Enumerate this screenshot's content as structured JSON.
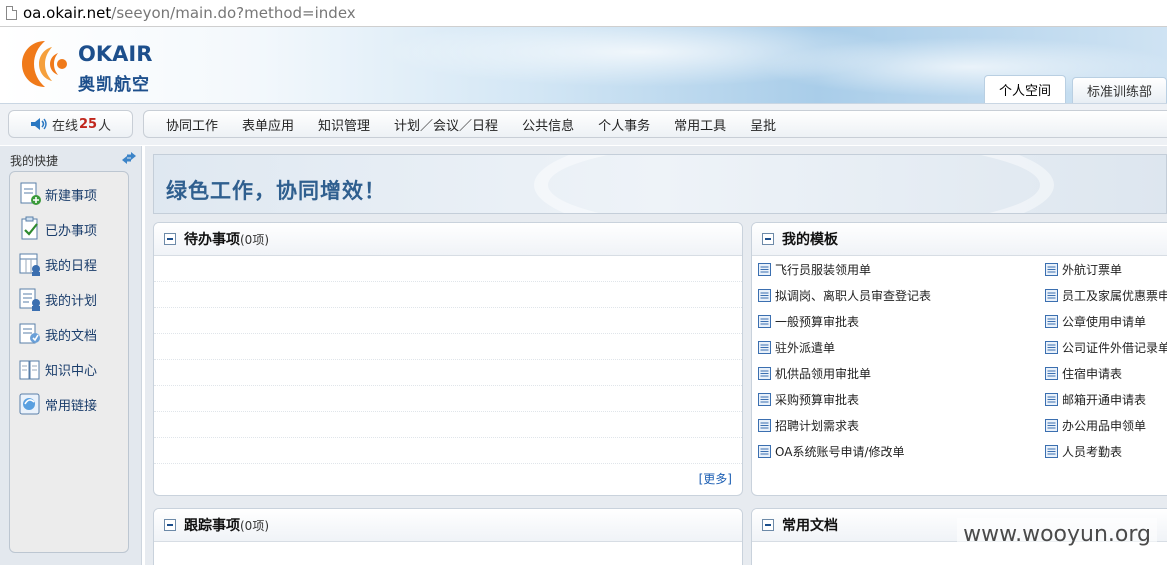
{
  "address_bar": {
    "domain": "oa.okair.net",
    "path": "/seeyon/main.do?method=index"
  },
  "header": {
    "logo_en": "OKAIR",
    "logo_cn": "奥凯航空",
    "tabs": [
      {
        "label": "个人空间",
        "active": true
      },
      {
        "label": "标准训练部",
        "active": false
      }
    ]
  },
  "online": {
    "prefix": "在线",
    "count": "25",
    "suffix": "人"
  },
  "menu": {
    "items": [
      "协同工作",
      "表单应用",
      "知识管理",
      "计划／会议／日程",
      "公共信息",
      "个人事务",
      "常用工具",
      "呈批"
    ]
  },
  "sidebar": {
    "title": "我的快捷",
    "items": [
      {
        "label": "新建事项",
        "icon": "new-item-icon"
      },
      {
        "label": "已办事项",
        "icon": "done-items-icon"
      },
      {
        "label": "我的日程",
        "icon": "calendar-icon"
      },
      {
        "label": "我的计划",
        "icon": "plan-icon"
      },
      {
        "label": "我的文档",
        "icon": "document-icon"
      },
      {
        "label": "知识中心",
        "icon": "book-icon"
      },
      {
        "label": "常用链接",
        "icon": "link-icon"
      }
    ]
  },
  "banner": {
    "slogan": "绿色工作，协同增效！"
  },
  "panels": {
    "todo": {
      "title": "待办事项",
      "count": "(0项)",
      "more": "[更多]"
    },
    "templates": {
      "title": "我的模板",
      "items_left": [
        "飞行员服装领用单",
        "拟调岗、离职人员审查登记表",
        "一般预算审批表",
        "驻外派遣单",
        "机供品领用审批单",
        "采购预算审批表",
        "招聘计划需求表",
        "OA系统账号申请/修改单"
      ],
      "items_right": [
        "外航订票单",
        "员工及家属优惠票申",
        "公章使用申请单",
        "公司证件外借记录单",
        "住宿申请表",
        "邮箱开通申请表",
        "办公用品申领单",
        "人员考勤表"
      ]
    },
    "tracking": {
      "title": "跟踪事项",
      "count": "(0项)"
    },
    "documents": {
      "title": "常用文档"
    }
  },
  "watermark": "www.wooyun.org",
  "colors": {
    "brand": "#1d4f8c",
    "logo_orange": "#f07a1a",
    "accent_red": "#c0261c",
    "link_blue": "#1d5fb3"
  }
}
